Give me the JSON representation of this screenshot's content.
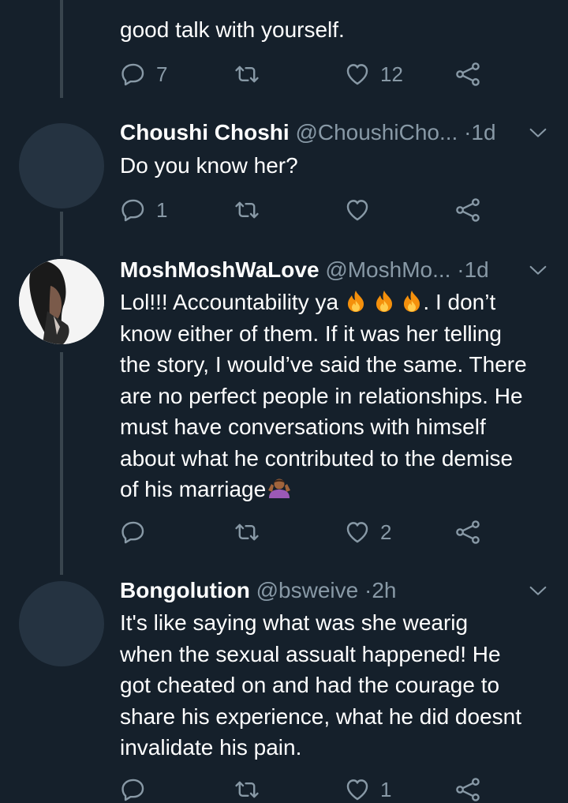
{
  "tweets": [
    {
      "text": "good talk with yourself.",
      "reply_count": "7",
      "retweet_count": "",
      "like_count": "12"
    },
    {
      "name": "Choushi Choshi",
      "handle": "@ChoushiCho...",
      "separator": "·",
      "time": "1d",
      "text": "Do you know her?",
      "reply_count": "1",
      "retweet_count": "",
      "like_count": ""
    },
    {
      "name": "MoshMoshWaLove",
      "handle": "@MoshMo...",
      "separator": "·",
      "time": "1d",
      "text_a": "Lol!!! Accountability ya ",
      "text_b": ". I don’t\nknow either of them. If it was her telling\nthe story, I would’ve said the same. There\nare no perfect people in relationships. He\nmust have conversations with himself\nabout what he contributed to the demise\nof his marriage",
      "reply_count": "",
      "retweet_count": "",
      "like_count": "2"
    },
    {
      "name": "Bongolution",
      "handle": "@bsweive",
      "separator": "·",
      "time": "2h",
      "text": "It's like saying what was she wearig\nwhen the sexual assualt happened! He\ngot cheated on and had the courage to\nshare his experience, what he did doesnt\ninvalidate his pain.",
      "reply_count": "",
      "retweet_count": "",
      "like_count": "1"
    }
  ],
  "icons": {
    "reply": "reply-icon",
    "retweet": "retweet-icon",
    "like": "heart-icon",
    "share": "share-icon",
    "caret": "chevron-down-icon",
    "fire": "fire-emoji",
    "shrug": "shrug-emoji"
  },
  "colors": {
    "background": "#15202b",
    "secondary_text": "#8899a6",
    "thread_line": "#38444d",
    "avatar_placeholder": "#253341"
  }
}
